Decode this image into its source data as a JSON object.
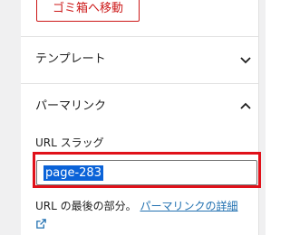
{
  "actions": {
    "move_to_trash_label": "ゴミ箱へ移動"
  },
  "sections": {
    "template": {
      "title": "テンプレート"
    },
    "permalink": {
      "title": "パーマリンク"
    }
  },
  "permalink": {
    "slug_label": "URL スラッグ",
    "slug_value": "page-283",
    "help_text": "URL の最後の部分。",
    "help_link_label": "パーマリンクの詳細"
  },
  "colors": {
    "accent": "#2271b1",
    "danger": "#cc1818",
    "selection": "#0b63d8",
    "highlight": "#e0111a"
  }
}
